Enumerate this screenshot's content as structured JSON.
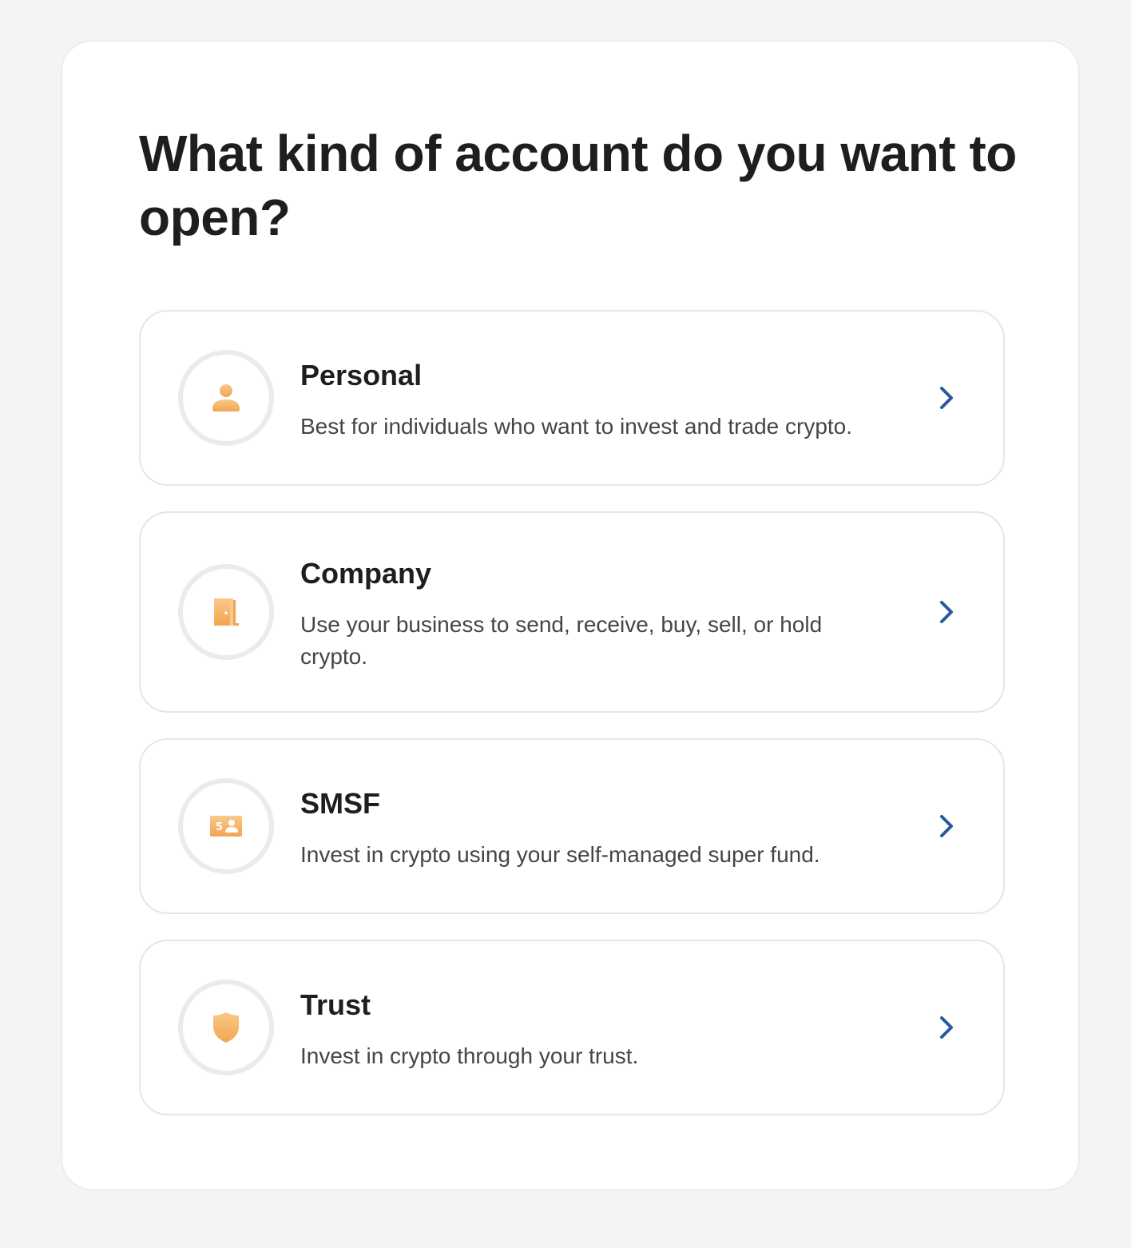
{
  "page": {
    "title": "What kind of account do you want to open?"
  },
  "options": [
    {
      "title": "Personal",
      "description": "Best for individuals who want to invest and trade crypto.",
      "icon": "person-icon"
    },
    {
      "title": "Company",
      "description": "Use your business to send, receive, buy, sell, or hold crypto.",
      "icon": "door-icon"
    },
    {
      "title": "SMSF",
      "description": "Invest in crypto using your self-managed super fund.",
      "icon": "id-card-icon",
      "icon_text": "5"
    },
    {
      "title": "Trust",
      "description": "Invest in crypto through your trust.",
      "icon": "shield-icon"
    }
  ],
  "colors": {
    "accent": "#2a5a9c",
    "icon_orange": "#f2a54f",
    "icon_orange_light": "#f8c98a",
    "ring": "#ebebeb",
    "background": "#f4f4f4"
  }
}
